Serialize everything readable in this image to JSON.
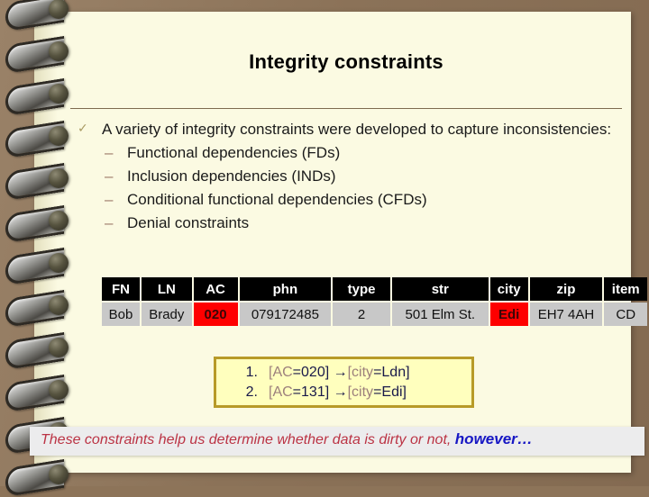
{
  "slide": {
    "title": "Integrity constraints",
    "background_color": "#8d7459",
    "page_color": "#fbfae2"
  },
  "bullets": {
    "check_glyph": "✓",
    "dash_glyph": "–",
    "level1": "A variety of integrity constraints were developed to capture inconsistencies:",
    "level2": [
      "Functional dependencies (FDs)",
      "Inclusion dependencies (INDs)",
      "Conditional functional dependencies (CFDs)",
      "Denial constraints"
    ]
  },
  "table": {
    "headers": [
      "FN",
      "LN",
      "AC",
      "phn",
      "type",
      "str",
      "city",
      "zip",
      "item"
    ],
    "row": [
      "Bob",
      "Brady",
      "020",
      "079172485",
      "2",
      "501 Elm St.",
      "Edi",
      "EH7 4AH",
      "CD"
    ],
    "highlighted_columns": [
      "AC",
      "city"
    ],
    "header_bg": "#000000",
    "header_color": "#ffffff",
    "cell_bg": "#c8c8c8",
    "highlight_bg": "#fe0000"
  },
  "cfd_box": {
    "border_color": "#b79a28",
    "background_color": "#ffffbe",
    "arrow_glyph": "→",
    "rules": [
      {
        "number": "1.",
        "lhs_attr": "[AC",
        "lhs_val": "=020]",
        "rhs_attr": "[city",
        "rhs_val": "=Ldn]"
      },
      {
        "number": "2.",
        "lhs_attr": "[AC",
        "lhs_val": "=131]",
        "rhs_attr": "[city",
        "rhs_val": "=Edi]"
      }
    ]
  },
  "caption": {
    "text": "These constraints help us determine whether data is dirty or not,",
    "emphasis": "however…",
    "text_color": "#bb3344",
    "emphasis_color": "#1717c4"
  }
}
